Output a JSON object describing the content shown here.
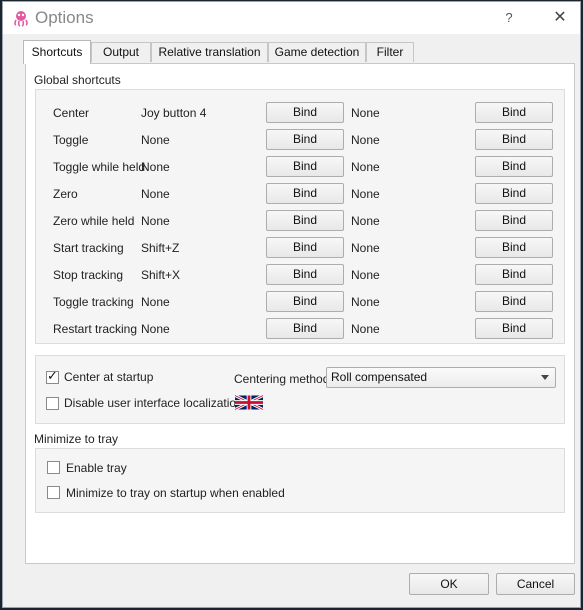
{
  "window": {
    "title": "Options",
    "help": "?",
    "close": "✕"
  },
  "tabs": [
    {
      "label": "Shortcuts",
      "active": true
    },
    {
      "label": "Output",
      "active": false
    },
    {
      "label": "Relative translation",
      "active": false
    },
    {
      "label": "Game detection",
      "active": false
    },
    {
      "label": "Filter",
      "active": false
    }
  ],
  "global_shortcuts": {
    "label": "Global shortcuts",
    "bind_label": "Bind",
    "rows": [
      {
        "name": "Center",
        "key1": "Joy button 4",
        "key2": "None"
      },
      {
        "name": "Toggle",
        "key1": "None",
        "key2": "None"
      },
      {
        "name": "Toggle while held",
        "key1": "None",
        "key2": "None"
      },
      {
        "name": "Zero",
        "key1": "None",
        "key2": "None"
      },
      {
        "name": "Zero while held",
        "key1": "None",
        "key2": "None"
      },
      {
        "name": "Start tracking",
        "key1": "Shift+Z",
        "key2": "None"
      },
      {
        "name": "Stop tracking",
        "key1": "Shift+X",
        "key2": "None"
      },
      {
        "name": "Toggle tracking",
        "key1": "None",
        "key2": "None"
      },
      {
        "name": "Restart tracking",
        "key1": "None",
        "key2": "None"
      }
    ]
  },
  "general": {
    "center_at_startup": {
      "label": "Center at startup",
      "checked": true
    },
    "centering_method_label": "Centering method",
    "centering_method_value": "Roll compensated",
    "disable_localization": {
      "label": "Disable user interface localization",
      "checked": false
    },
    "flag_icon": "uk-flag-icon"
  },
  "tray": {
    "label": "Minimize to tray",
    "enable_tray": {
      "label": "Enable tray",
      "checked": false
    },
    "minimize_on_startup": {
      "label": "Minimize to tray on startup when enabled",
      "checked": false
    }
  },
  "footer": {
    "ok": "OK",
    "cancel": "Cancel"
  }
}
